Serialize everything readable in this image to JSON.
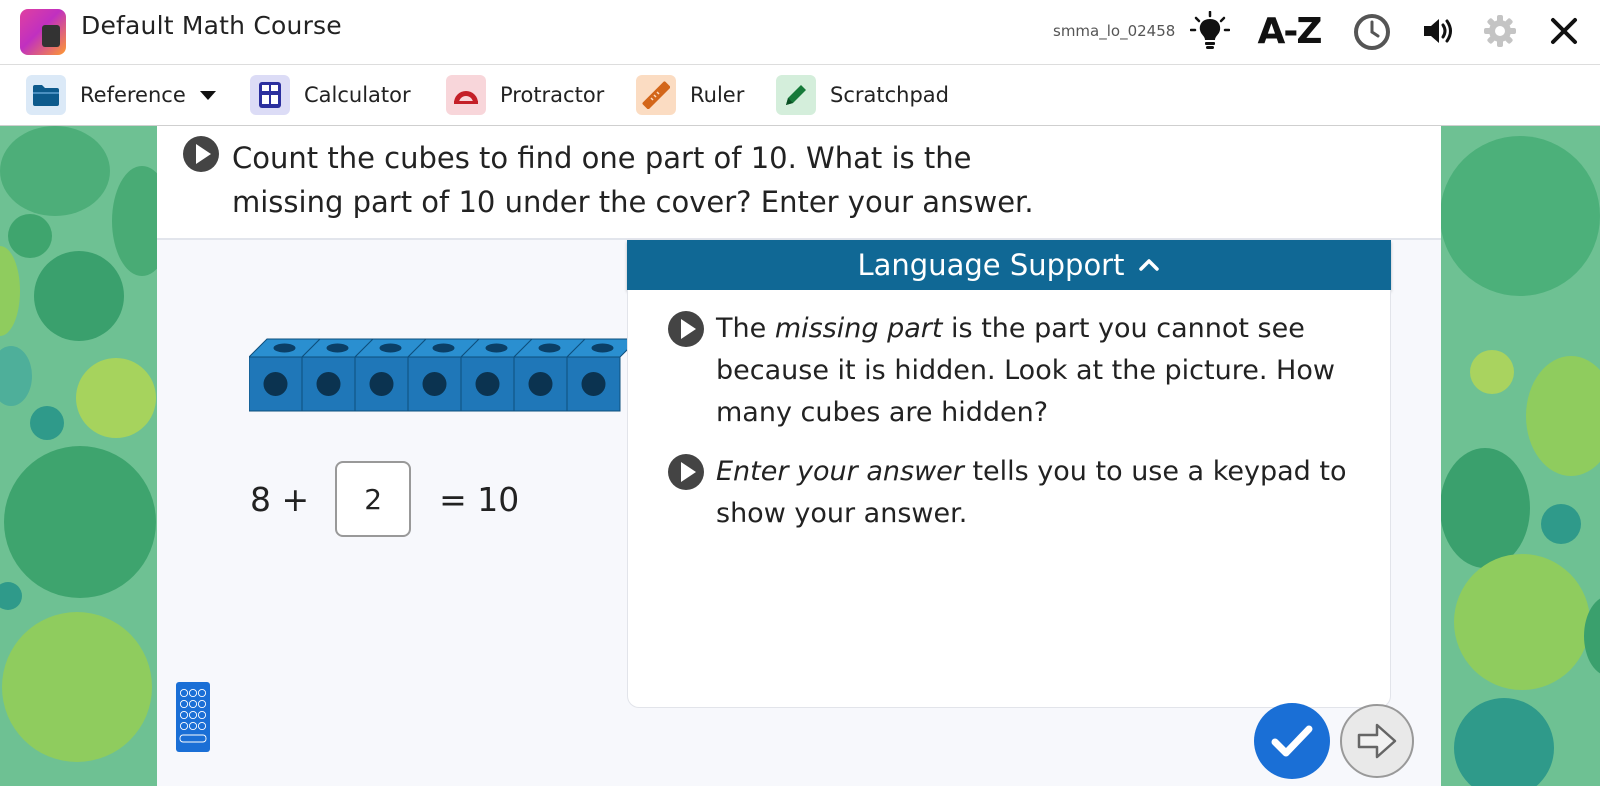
{
  "app": {
    "title": "Default Math Course",
    "lo_code": "smma_lo_02458"
  },
  "top_icons": [
    "lightbulb-icon",
    "a-z-icon",
    "timer-icon",
    "volume-icon",
    "gear-icon",
    "close-icon"
  ],
  "az_label": "A-Z",
  "toolbar": {
    "reference": "Reference",
    "calculator": "Calculator",
    "protractor": "Protractor",
    "ruler": "Ruler",
    "scratchpad": "Scratchpad"
  },
  "question": {
    "line1": "Count the cubes to find one part of 10. What is the",
    "line2": "missing part of 10 under the cover? Enter your answer."
  },
  "equation": {
    "left": "8 +",
    "answer": "2",
    "right": "= 10"
  },
  "cubes_visible": 7,
  "language_support": {
    "title": "Language Support",
    "item1": {
      "pre": "The ",
      "term": "missing part",
      "post": " is the part you cannot see because it is hidden. Look at the picture. How many cubes are hidden?"
    },
    "item2": {
      "term": "Enter your answer",
      "post": " tells you to use a keypad to show your answer."
    }
  },
  "colors": {
    "accent": "#1a6fd6",
    "language_header": "#106895",
    "background": "#6ec193",
    "cube": "#1f77b8"
  }
}
